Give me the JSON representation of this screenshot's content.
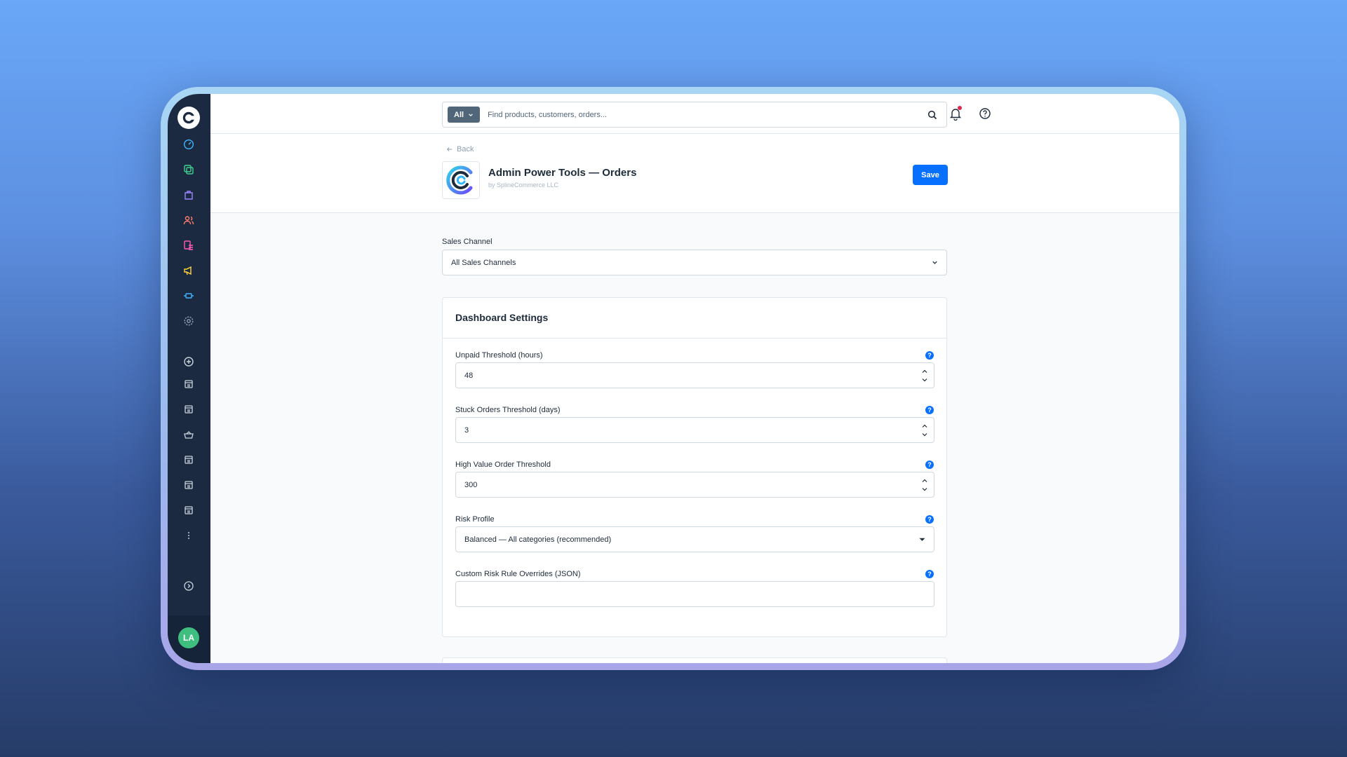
{
  "search": {
    "type_label": "All",
    "placeholder": "Find products, customers, orders..."
  },
  "header": {
    "back_label": "Back",
    "title": "Admin Power Tools — Orders",
    "vendor": "by SplineCommerce LLC",
    "save_label": "Save"
  },
  "sales_channel": {
    "label": "Sales Channel",
    "value": "All Sales Channels"
  },
  "dashboard": {
    "title": "Dashboard Settings",
    "fields": [
      {
        "label": "Unpaid Threshold (hours)",
        "value": "48"
      },
      {
        "label": "Stuck Orders Threshold (days)",
        "value": "3"
      },
      {
        "label": "High Value Order Threshold",
        "value": "300"
      },
      {
        "label": "Risk Profile",
        "value": "Balanced — All categories (recommended)"
      },
      {
        "label": "Custom Risk Rule Overrides (JSON)",
        "value": ""
      }
    ],
    "help_glyph": "?"
  },
  "user": {
    "initials": "LA"
  },
  "colors": {
    "accent": "#0870ff",
    "sidebar_bg": "#1b2a40",
    "avatar_bg": "#3fbf7f",
    "notification_dot": "#de294c"
  },
  "icons": {
    "sidebar": [
      "dashboard-icon",
      "orders-icon",
      "catalog-icon",
      "customers-icon",
      "content-icon",
      "marketing-icon",
      "extensions-icon",
      "settings-icon",
      "add-icon",
      "app-icon",
      "app-icon",
      "basket-icon",
      "app-icon",
      "app-icon",
      "app-icon",
      "more-icon",
      "collapse-icon"
    ],
    "top": [
      "bell-icon",
      "help-icon"
    ]
  }
}
